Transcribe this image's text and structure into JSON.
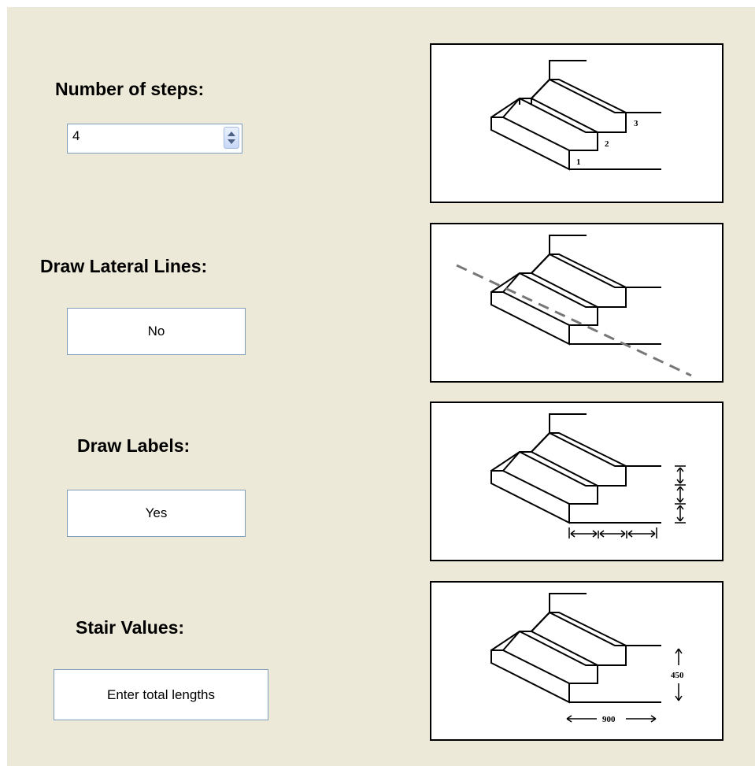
{
  "steps": {
    "label": "Number of steps:",
    "value": "4"
  },
  "lateral": {
    "label": "Draw Lateral Lines:",
    "button": "No"
  },
  "labels": {
    "label": "Draw Labels:",
    "button": "Yes"
  },
  "values": {
    "label": "Stair Values:",
    "button": "Enter total lengths"
  },
  "preview": {
    "step_numbers": [
      "1",
      "2",
      "3"
    ],
    "dim_width": "900",
    "dim_height": "450"
  }
}
